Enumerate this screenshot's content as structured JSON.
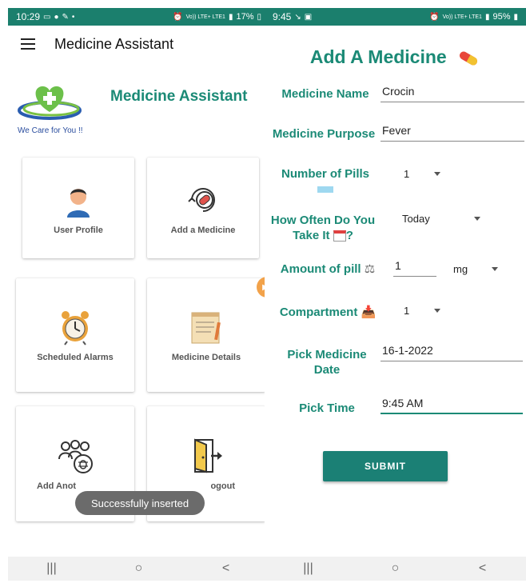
{
  "left": {
    "status": {
      "time": "10:29",
      "battery": "17%",
      "network": "Vo)) LTE+ LTE1"
    },
    "app_bar": {
      "title": "Medicine Assistant"
    },
    "brand": {
      "title": "Medicine Assistant",
      "tagline": "We Care for You !!"
    },
    "cards": [
      {
        "label": "User Profile",
        "icon": "user-avatar-icon"
      },
      {
        "label": "Add a Medicine",
        "icon": "add-pill-icon"
      },
      {
        "label": "Scheduled Alarms",
        "icon": "alarm-clock-icon"
      },
      {
        "label": "Medicine Details",
        "icon": "notepad-icon"
      },
      {
        "label": "Add Anot",
        "icon": "group-bug-icon"
      },
      {
        "label": "ogout",
        "icon": "exit-door-icon"
      }
    ],
    "toast": "Successfully inserted"
  },
  "right": {
    "status": {
      "time": "9:45",
      "battery": "95%",
      "network": "Vo)) LTE+ LTE1"
    },
    "title": "Add A Medicine",
    "fields": {
      "medicine_name": {
        "label": "Medicine Name",
        "value": "Crocin"
      },
      "medicine_purpose": {
        "label": "Medicine Purpose",
        "value": "Fever"
      },
      "number_of_pills": {
        "label": "Number of Pills",
        "value": "1"
      },
      "how_often": {
        "label_line1": "How Often Do You",
        "label_line2": "Take It",
        "value": "Today"
      },
      "amount_of_pill": {
        "label": "Amount of pill",
        "value": "1",
        "unit": "mg"
      },
      "compartment": {
        "label": "Compartment",
        "value": "1"
      },
      "pick_date": {
        "label_line1": "Pick Medicine",
        "label_line2": "Date",
        "value": "16-1-2022"
      },
      "pick_time": {
        "label": "Pick Time",
        "value": "9:45 AM"
      }
    },
    "submit_label": "SUBMIT"
  },
  "nav": {
    "recent": "|||",
    "home": "○",
    "back": "<"
  },
  "colors": {
    "accent": "#1b8a76",
    "status_bar": "#1b7f6d",
    "button": "#1b8075"
  }
}
